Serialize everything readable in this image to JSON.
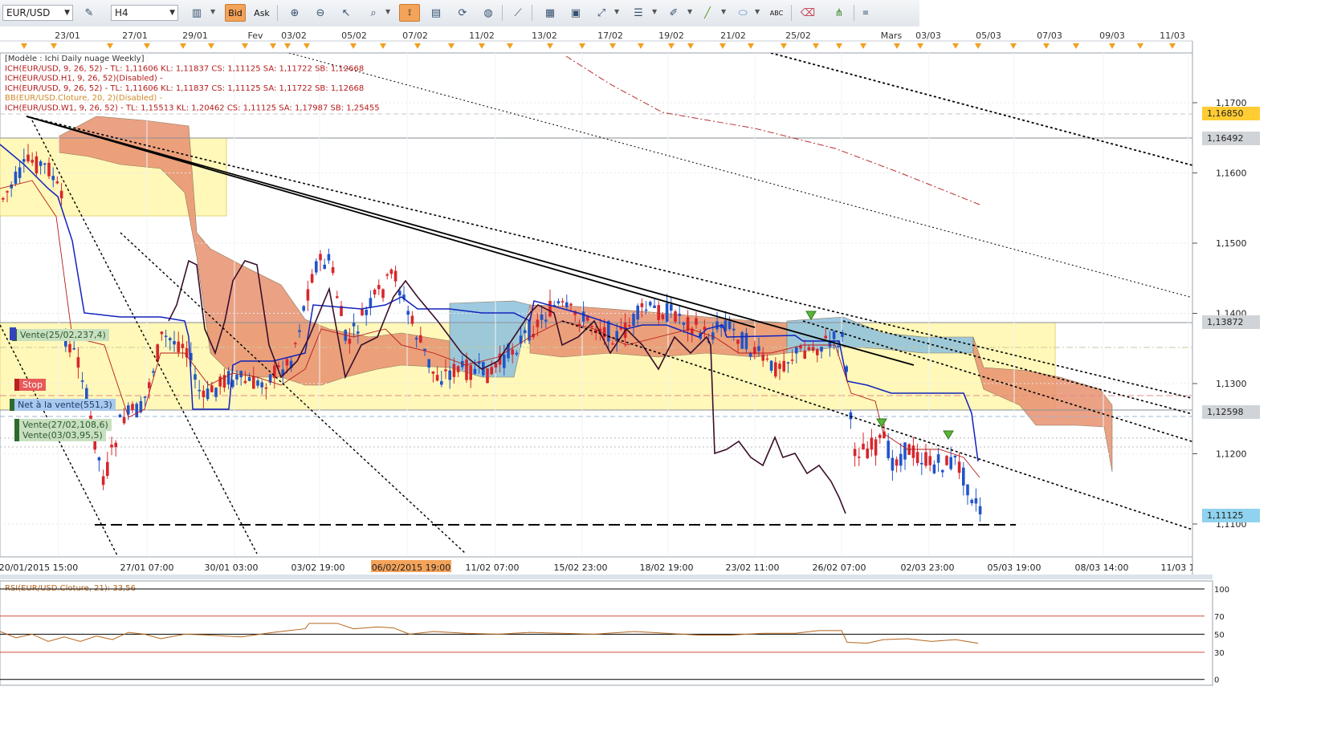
{
  "toolbar": {
    "symbol": "EUR/USD",
    "timeframe": "H4",
    "bid_label": "Bid",
    "ask_label": "Ask",
    "abc_label": "ABC",
    "icons": [
      "chart-type-icon",
      "cross-hair-icon",
      "zoom-in-icon",
      "zoom-out-icon",
      "cursor-icon",
      "zoom-box-icon",
      "candle-width-icon",
      "snapshot-icon",
      "refresh-icon",
      "globe-icon",
      "ruler-icon",
      "chart-image-icon",
      "print-chart-icon",
      "arrow-tool-icon",
      "horizontal-lines-icon",
      "pencil-icon",
      "trend-line-icon",
      "ellipse-icon",
      "text-tool-icon",
      "eraser-icon",
      "indicator-tree-icon"
    ]
  },
  "top_dates": [
    "23/01",
    "27/01",
    "29/01",
    "Fev",
    "03/02",
    "05/02",
    "07/02",
    "11/02",
    "13/02",
    "17/02",
    "19/02",
    "21/02",
    "25/02",
    "Mars",
    "03/03",
    "05/03",
    "07/03",
    "09/03",
    "11/03"
  ],
  "bottom_dates": [
    "20/01/2015 15:00",
    "27/01 07:00",
    "30/01 03:00",
    "03/02 19:00",
    "06/02/2015 19:00",
    "11/02 07:00",
    "15/02 23:00",
    "18/02 19:00",
    "23/02 11:00",
    "26/02 07:00",
    "02/03 23:00",
    "05/03 19:00",
    "08/03 14:00",
    "11/03 10:00"
  ],
  "legend": [
    "[Modèle : Ichi Daily nuage Weekly]",
    "ICH(EUR/USD, 9, 26, 52) -  TL: 1,11606  KL: 1,11837  CS: 1,11125  SA: 1,11722  SB: 1,12668",
    "ICH(EUR/USD.H1, 9, 26, 52)(Disabled) -",
    "ICH(EUR/USD, 9, 26, 52) -  TL: 1,11606  KL: 1,11837  CS: 1,11125  SA: 1,11722  SB: 1,12668",
    "BB(EUR/USD.Cloture, 20, 2)(Disabled) -",
    "ICH(EUR/USD.W1, 9, 26, 52) -  TL: 1,15513  KL: 1,20462  CS: 1,11125  SA: 1,17987  SB: 1,25455"
  ],
  "order_labels": {
    "sell_1": "Vente(25/02,237,4)",
    "stop": "Stop",
    "net": "Net à la vente(551,3)",
    "sell_2": "Vente(27/02,108,6)",
    "sell_3": "Vente(03/03,95,5)"
  },
  "price_axis": {
    "ticks": [
      "1,1700",
      "1,1600",
      "1,1500",
      "1,1400",
      "1,1300",
      "1,1200",
      "1,1100"
    ],
    "labels": [
      {
        "text": "1,16850",
        "color": "#ffcc33",
        "value": 1.1685
      },
      {
        "text": "1,16492",
        "color": "#d0d4d8",
        "value": 1.16492
      },
      {
        "text": "1,13872",
        "color": "#d0d4d8",
        "value": 1.13872
      },
      {
        "text": "1,12598",
        "color": "#d0d4d8",
        "value": 1.12598
      },
      {
        "text": "1,11125",
        "color": "#8fd3f0",
        "value": 1.11125
      }
    ]
  },
  "rsi": {
    "title": "RSI(EUR/USD.Cloture, 21): 33,56",
    "levels": [
      "100",
      "70",
      "50",
      "30",
      "0"
    ]
  },
  "chart_data": {
    "type": "line",
    "title": "EUR/USD H4",
    "ylim": [
      1.104,
      1.175
    ],
    "support_level": 1.1097,
    "last_close": 1.11125,
    "rsi_last": 33.56,
    "series": [
      {
        "name": "Ichimoku Tenkan (TL)",
        "last": 1.11606
      },
      {
        "name": "Ichimoku Kijun (KL)",
        "last": 1.11837
      },
      {
        "name": "Chikou span (CS)",
        "last": 1.11125
      },
      {
        "name": "Senkou A (SA)",
        "last": 1.11722
      },
      {
        "name": "Senkou B (SB)",
        "last": 1.12668
      }
    ]
  },
  "colors": {
    "bull": "#2155c9",
    "bear": "#d8262c",
    "cloud_red": "#e48c6e",
    "cloud_blue": "#7fb7d6",
    "zone": "#fff8b8",
    "kijun": "#1122bb",
    "chikou": "#3a0f2b"
  }
}
